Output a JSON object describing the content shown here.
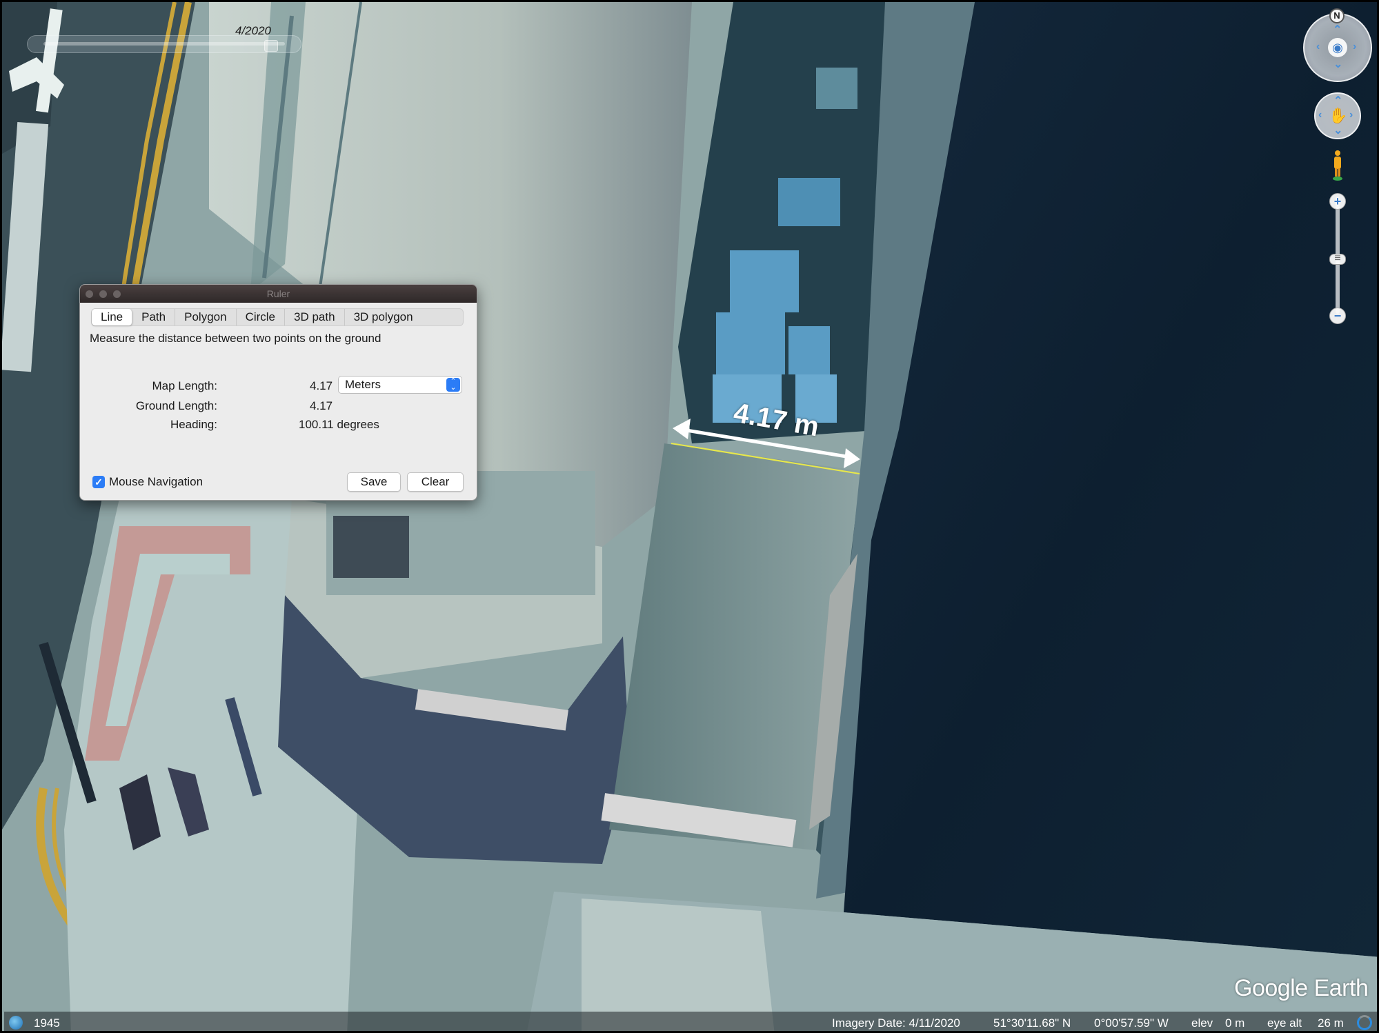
{
  "map": {
    "time_slider_label": "4/2020",
    "measurement_label": "4.17 m"
  },
  "nav": {
    "north_label": "N",
    "zoom_in": "+",
    "zoom_out": "−"
  },
  "ruler": {
    "title": "Ruler",
    "tabs": [
      "Line",
      "Path",
      "Polygon",
      "Circle",
      "3D path",
      "3D polygon"
    ],
    "active_tab": "Line",
    "description": "Measure the distance between two points on the ground",
    "map_length_label": "Map Length:",
    "map_length_value": "4.17",
    "unit": "Meters",
    "ground_length_label": "Ground Length:",
    "ground_length_value": "4.17",
    "heading_label": "Heading:",
    "heading_value": "100.11 degrees",
    "mouse_navigation_label": "Mouse Navigation",
    "mouse_navigation_checked": true,
    "save_label": "Save",
    "clear_label": "Clear"
  },
  "status": {
    "year": "1945",
    "imagery_date": "Imagery Date: 4/11/2020",
    "latitude": "51°30'11.68\" N",
    "longitude": "0°00'57.59\" W",
    "elev_label": "elev",
    "elev_value": "0 m",
    "eye_alt_label": "eye alt",
    "eye_alt_value": "26 m",
    "logo": "Google Earth"
  },
  "colors": {
    "accent": "#2b7cf6",
    "measure_line": "#ffffff",
    "ground_line": "#e8e84a",
    "water": "#0e2236"
  }
}
